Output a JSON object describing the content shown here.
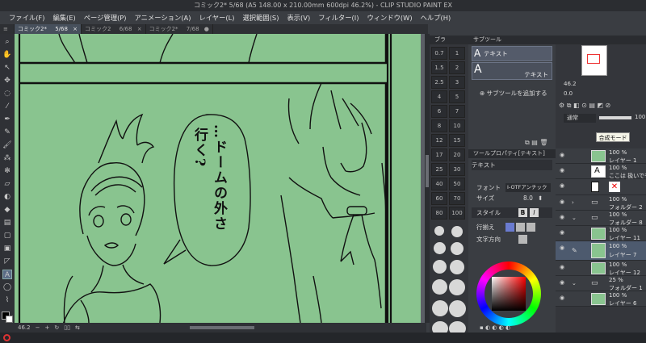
{
  "window": {
    "title": "コミック2* 5/68 (A5 148.00 x 210.00mm 600dpi 46.2%) - CLIP STUDIO PAINT EX"
  },
  "menu": [
    "ファイル(F)",
    "編集(E)",
    "ページ管理(P)",
    "アニメーション(A)",
    "レイヤー(L)",
    "選択範囲(S)",
    "表示(V)",
    "フィルター(I)",
    "ウィンドウ(W)",
    "ヘルプ(H)"
  ],
  "tabs": [
    {
      "label": "コミック2*",
      "page": "5/68",
      "active": true
    },
    {
      "label": "コミック2",
      "page": "6/68",
      "active": false
    },
    {
      "label": "コミック2*",
      "page": "7/68",
      "active": false
    }
  ],
  "canvas": {
    "bubble_text_col1": "…ドームの外さ",
    "bubble_text_col2": "行く?",
    "zoom": "46.2",
    "paper_color": "#89c48f"
  },
  "brush_panel": {
    "header": "ブラ",
    "sizes": [
      "0.7",
      "1",
      "1.5",
      "2",
      "2.5",
      "3",
      "4",
      "5",
      "6",
      "7",
      "8",
      "10",
      "12",
      "15",
      "17",
      "20",
      "25",
      "30",
      "40",
      "50",
      "60",
      "70",
      "80",
      "100"
    ]
  },
  "subtool_panel": {
    "header": "サブツール",
    "items": [
      {
        "label": "テキスト"
      },
      {
        "label": "テキスト"
      }
    ],
    "add_label": "サブツールを追加する"
  },
  "tool_property": {
    "header": "ツールプロパティ[テキスト]",
    "tool_name": "テキスト",
    "font_label": "フォント",
    "font_value": "I-OTFアンチック",
    "size_label": "サイズ",
    "size_value": "8.0",
    "style_label": "スタイル",
    "style_b": "B",
    "style_i": "I",
    "align_label": "行揃え",
    "direction_label": "文字方向"
  },
  "navigator": {
    "zoom": "46.2",
    "angle": "0.0"
  },
  "layer_panel": {
    "blend_mode": "通常",
    "opacity": "100",
    "tooltip": "合成モード",
    "layers": [
      {
        "pct": "100 %",
        "mode": "通常",
        "name": "レイヤー 1",
        "selected": false
      },
      {
        "pct": "100 %",
        "mode": "通常",
        "name": "ここは 扱いでも 同様に",
        "selected": false
      },
      {
        "pct": "",
        "mode": "",
        "name": "",
        "selected": false
      },
      {
        "pct": "100 %",
        "mode": "通常",
        "name": "フォルダー 2",
        "selected": false
      },
      {
        "pct": "100 %",
        "mode": "通常",
        "name": "フォルダー 8",
        "selected": false
      },
      {
        "pct": "100 %",
        "mode": "",
        "name": "レイヤー 11",
        "selected": false
      },
      {
        "pct": "100 %",
        "mode": "",
        "name": "レイヤー 7",
        "selected": true
      },
      {
        "pct": "100 %",
        "mode": "",
        "name": "レイヤー 12",
        "selected": false
      },
      {
        "pct": "25 %",
        "mode": "通常",
        "name": "フォルダー 1",
        "selected": false
      },
      {
        "pct": "100 %",
        "mode": "",
        "name": "レイヤー 6",
        "selected": false
      }
    ]
  },
  "statusbar": {
    "zoom": "46.2"
  }
}
